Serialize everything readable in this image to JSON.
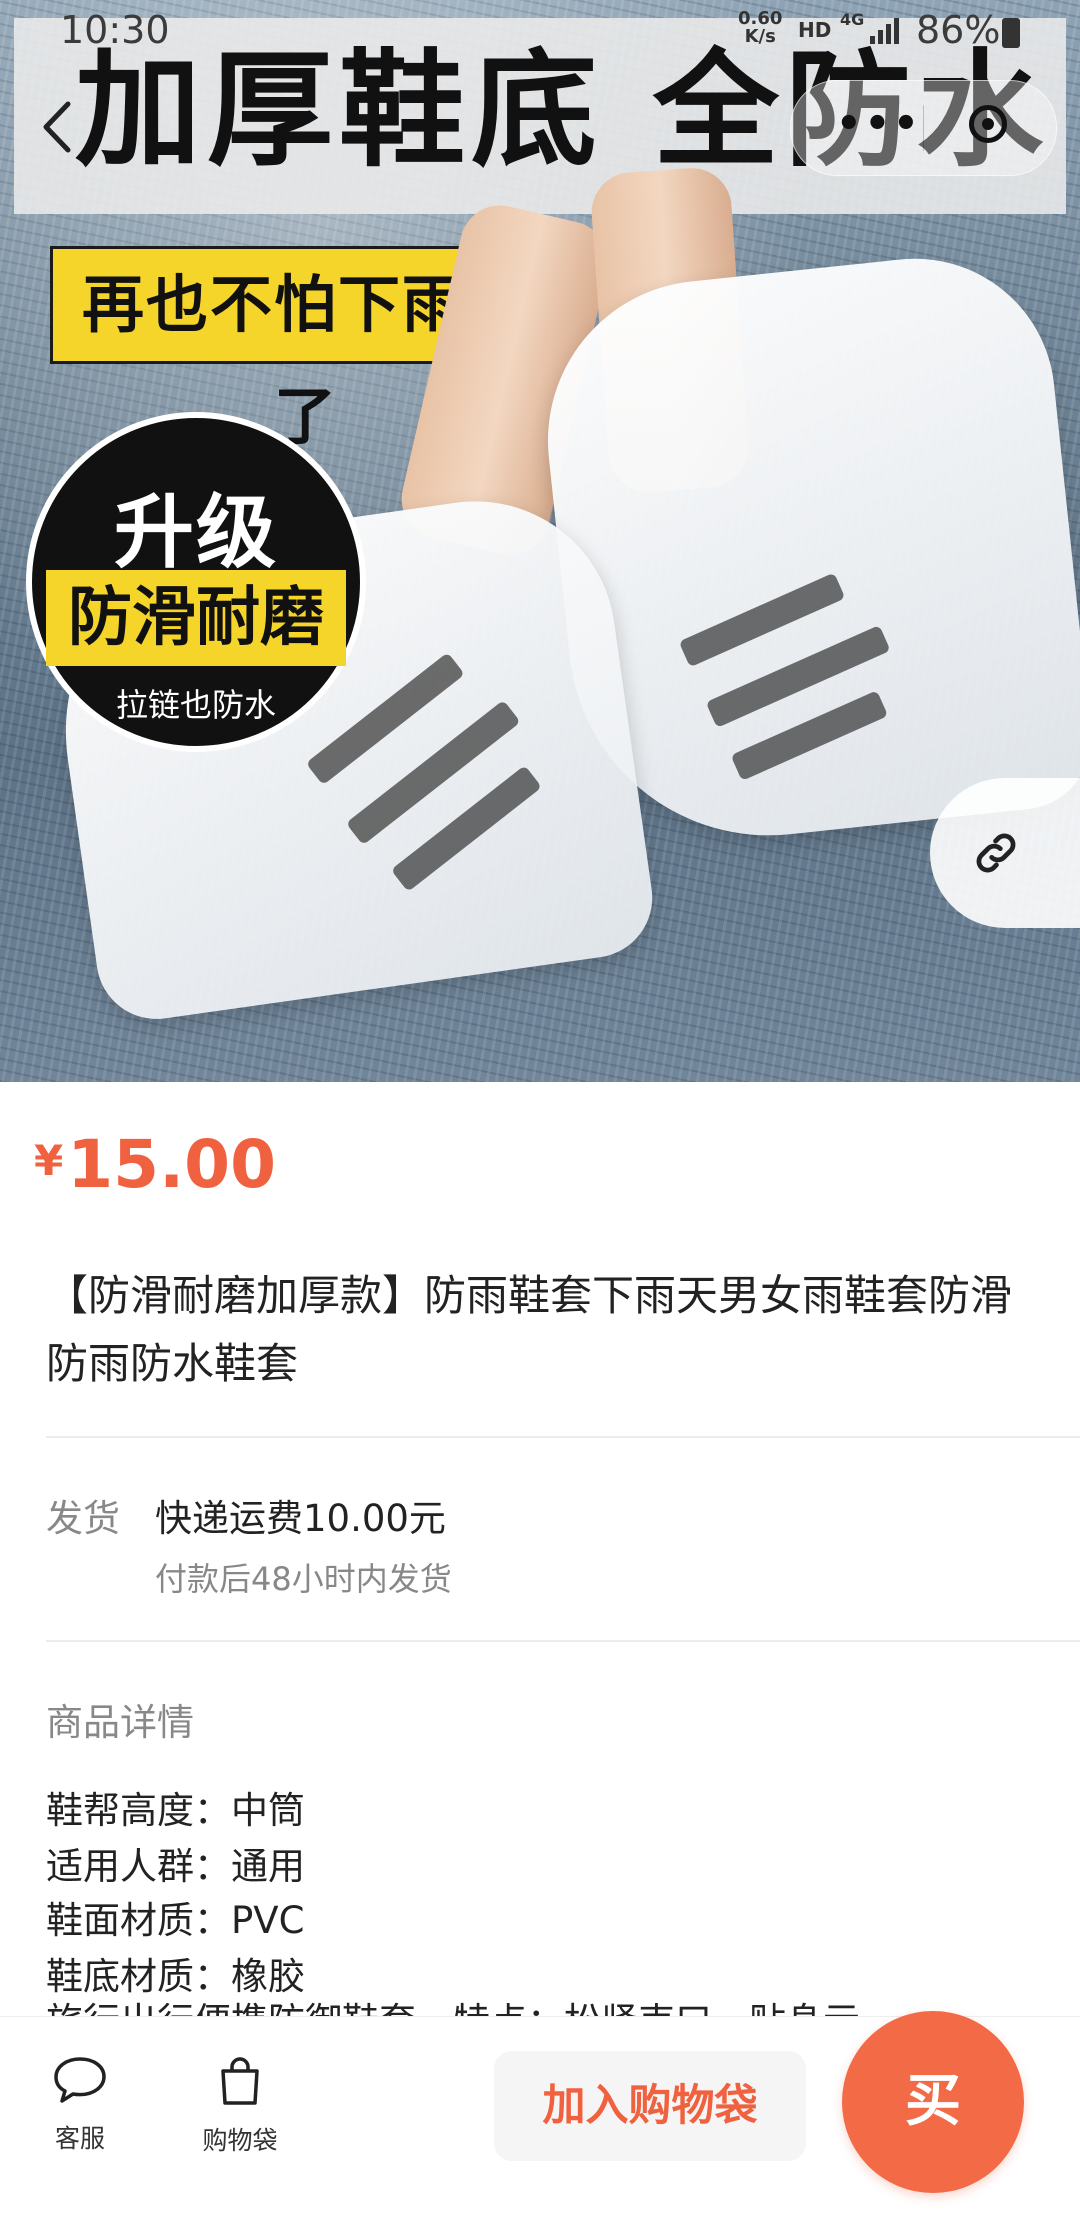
{
  "status_bar": {
    "time": "10:30",
    "net_rate_value": "0.60",
    "net_rate_unit": "K/s",
    "hd": "HD",
    "network": "4G",
    "battery": "86%"
  },
  "hero": {
    "title": "加厚鞋底 全防水",
    "tagline": "再也不怕下雨天了",
    "badge_top": "升级",
    "badge_mid": "防滑耐磨",
    "badge_bottom": "拉链也防水"
  },
  "product": {
    "currency": "¥",
    "price": "15.00",
    "title": "【防滑耐磨加厚款】防雨鞋套下雨天男女雨鞋套防滑防雨防水鞋套"
  },
  "shipping": {
    "label": "发货",
    "method": "快递运费10.00元",
    "note": "付款后48小时内发货"
  },
  "details": {
    "heading": "商品详情",
    "specs": [
      "鞋帮高度：中筒",
      "适用人群：通用",
      "鞋面材质：PVC",
      "鞋底材质：橡胶"
    ],
    "truncated_line": "旅行出行便携防御鞋套，特点：松紧束口，贴身示"
  },
  "bottom_bar": {
    "service_label": "客服",
    "bag_label": "购物袋",
    "add_to_bag": "加入购物袋",
    "buy": "买"
  },
  "colors": {
    "accent": "#f0623f",
    "buy_button": "#f26a46",
    "muted_text": "#888888"
  }
}
